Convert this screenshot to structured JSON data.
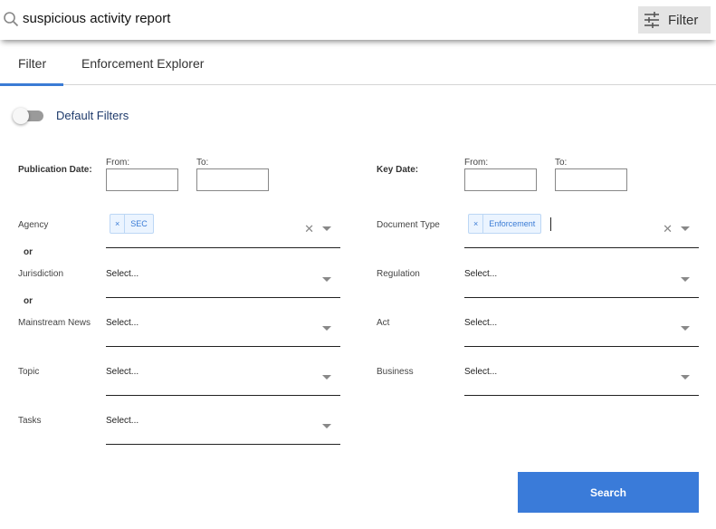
{
  "search": {
    "query": "suspicious activity report",
    "filter_button_label": "Filter"
  },
  "tabs": [
    {
      "label": "Filter",
      "active": true
    },
    {
      "label": "Enforcement Explorer",
      "active": false
    }
  ],
  "default_filters": {
    "label": "Default Filters",
    "enabled": false
  },
  "publication_date": {
    "label": "Publication Date:",
    "from_label": "From:",
    "to_label": "To:",
    "from_value": "",
    "to_value": ""
  },
  "key_date": {
    "label": "Key Date:",
    "from_label": "From:",
    "to_label": "To:",
    "from_value": "",
    "to_value": ""
  },
  "or_label": "or",
  "fields": {
    "agency": {
      "label": "Agency",
      "selected": [
        "SEC"
      ]
    },
    "jurisdiction": {
      "label": "Jurisdiction",
      "placeholder": "Select..."
    },
    "mainstream_news": {
      "label": "Mainstream News",
      "placeholder": "Select..."
    },
    "topic": {
      "label": "Topic",
      "placeholder": "Select..."
    },
    "tasks": {
      "label": "Tasks",
      "placeholder": "Select..."
    },
    "document_type": {
      "label": "Document Type",
      "selected": [
        "Enforcement"
      ]
    },
    "regulation": {
      "label": "Regulation",
      "placeholder": "Select..."
    },
    "act": {
      "label": "Act",
      "placeholder": "Select..."
    },
    "business": {
      "label": "Business",
      "placeholder": "Select..."
    }
  },
  "chip_remove_glyph": "×",
  "clear_glyph": "✕",
  "search_button_label": "Search",
  "colors": {
    "accent": "#3a7bd9",
    "chip_bg": "#ebf4ff",
    "toggle_label": "#1e3a6b"
  }
}
